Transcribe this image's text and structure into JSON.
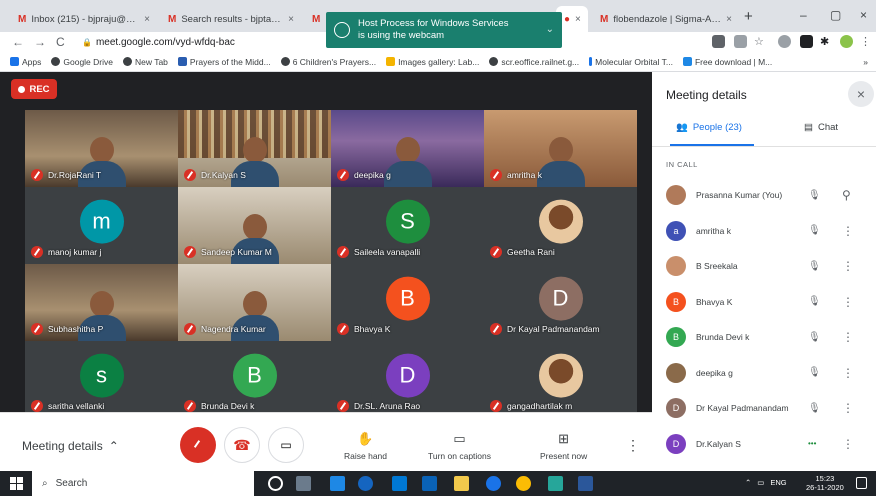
{
  "browser": {
    "tabs": [
      {
        "title": "Inbox (215) - bjpraju@gmail.c"
      },
      {
        "title": "Search results - bjptanuja@gm"
      },
      {
        "title": ""
      },
      {
        "title": "flobendazole | Sigma-Aldrich"
      }
    ],
    "new_tab_symbol": "+",
    "window_controls": [
      "–",
      "▢",
      "×"
    ],
    "url": "meet.google.com/vyd-wfdq-bac",
    "notification": {
      "line1": "Host Process for Windows Services",
      "line2": "is using the webcam"
    },
    "bookmarks": [
      "Apps",
      "Google Drive",
      "New Tab",
      "Prayers of the Midd...",
      "6 Children's Prayers...",
      "Images gallery: Lab...",
      "scr.eoffice.railnet.g...",
      "Molecular Orbital T...",
      "Free download | M..."
    ],
    "bookmarks_more": "»"
  },
  "meeting": {
    "rec_label": "REC",
    "tiles": [
      {
        "name": "Dr.RojaRani T",
        "type": "video"
      },
      {
        "name": "Dr.Kalyan S",
        "type": "video"
      },
      {
        "name": "deepika g",
        "type": "video"
      },
      {
        "name": "amritha k",
        "type": "video"
      },
      {
        "name": "manoj kumar j",
        "type": "avatar",
        "initial": "m",
        "color": "#0097a7"
      },
      {
        "name": "Sandeep Kumar M",
        "type": "video"
      },
      {
        "name": "Saileela vanapalli",
        "type": "avatar",
        "initial": "S",
        "color": "#1e8e3e"
      },
      {
        "name": "Geetha Rani",
        "type": "photo"
      },
      {
        "name": "Subhashitha P",
        "type": "video"
      },
      {
        "name": "Nagendra Kumar",
        "type": "video"
      },
      {
        "name": "Bhavya K",
        "type": "avatar",
        "initial": "B",
        "color": "#f4511e"
      },
      {
        "name": "Dr Kayal Padmanandam",
        "type": "avatar",
        "initial": "D",
        "color": "#8d6e63"
      },
      {
        "name": "saritha vellanki",
        "type": "avatar",
        "initial": "s",
        "color": "#0b8043"
      },
      {
        "name": "Brunda Devi k",
        "type": "avatar",
        "initial": "B",
        "color": "#33a852"
      },
      {
        "name": "Dr.SL. Aruna Rao",
        "type": "avatar",
        "initial": "D",
        "color": "#7b3fbf"
      },
      {
        "name": "gangadhartilak m",
        "type": "photo"
      }
    ]
  },
  "bottom_bar": {
    "meeting_details": "Meeting details",
    "raise_hand": "Raise hand",
    "turn_on_captions": "Turn on captions",
    "present_now": "Present now"
  },
  "panel": {
    "title": "Meeting details",
    "people_tab": "People (23)",
    "chat_tab": "Chat",
    "in_call": "IN CALL",
    "people": [
      {
        "name": "Prasanna Kumar (You)",
        "initial": "",
        "color": "#b07a5a"
      },
      {
        "name": "amritha k",
        "initial": "a",
        "color": "#3f51b5"
      },
      {
        "name": "B Sreekala",
        "initial": "",
        "color": "#c98f6b"
      },
      {
        "name": "Bhavya K",
        "initial": "B",
        "color": "#f4511e"
      },
      {
        "name": "Brunda Devi k",
        "initial": "B",
        "color": "#33a852"
      },
      {
        "name": "deepika g",
        "initial": "",
        "color": "#8a6a4a"
      },
      {
        "name": "Dr Kayal Padmanandam",
        "initial": "D",
        "color": "#8d6e63"
      },
      {
        "name": "Dr.Kalyan S",
        "initial": "D",
        "color": "#7b3fbf"
      }
    ]
  },
  "taskbar": {
    "search_placeholder": "Search",
    "tray": "ENG",
    "time": "15:23",
    "date": "26-11-2020"
  },
  "colors": {
    "accent": "#1a73e8",
    "danger": "#d93025",
    "meet_bg": "#202124"
  }
}
